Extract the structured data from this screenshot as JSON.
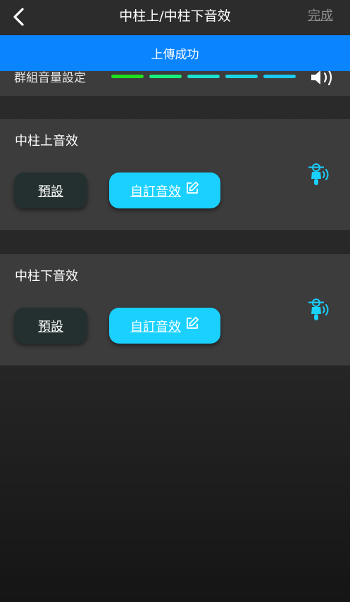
{
  "nav": {
    "title": "中柱上/中柱下音效",
    "done_label": "完成",
    "back_icon": "chevron-left-icon"
  },
  "toast": {
    "message": "上傳成功"
  },
  "volume": {
    "label": "群組音量設定",
    "level": 5,
    "max_level": 5,
    "bar_colors": [
      "#1fe01f",
      "#17f07a",
      "#19e0d0",
      "#19d4e6",
      "#19c8f0"
    ],
    "icon": "speaker-icon"
  },
  "sections": [
    {
      "title": "中柱上音效",
      "preset_label": "預設",
      "custom_label": "自訂音效",
      "icon": "scooter-sound-icon"
    },
    {
      "title": "中柱下音效",
      "preset_label": "預設",
      "custom_label": "自訂音效",
      "icon": "scooter-sound-icon"
    }
  ],
  "colors": {
    "accent": "#19d0ff",
    "toast": "#0a84ff",
    "card": "#3c3c3c",
    "preset_button": "#243030"
  }
}
